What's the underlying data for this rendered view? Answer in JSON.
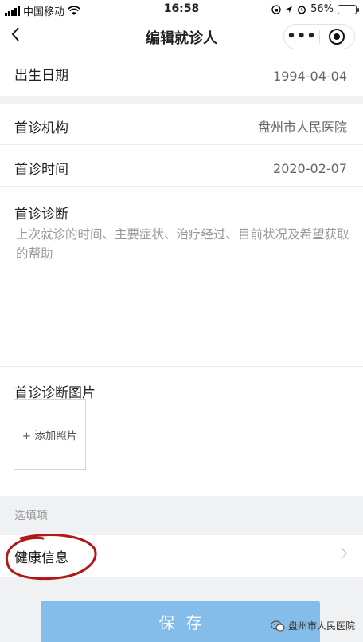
{
  "status_bar": {
    "carrier": "中国移动",
    "time": "16:58",
    "battery": "56%",
    "battery_level": 0.56
  },
  "nav": {
    "title": "编辑就诊人",
    "more_label": "•••"
  },
  "birth": {
    "label": "出生日期",
    "value": "1994-04-04"
  },
  "institution": {
    "label": "首诊机构",
    "value": "盘州市人民医院"
  },
  "visit_time": {
    "label": "首诊时间",
    "value": "2020-02-07"
  },
  "diagnosis": {
    "label": "首诊诊断",
    "placeholder": "上次就诊的时间、主要症状、治疗经过、目前状况及希望获取的帮助"
  },
  "photos": {
    "label": "首诊诊断图片",
    "add_label": "+ 添加照片"
  },
  "optional": {
    "section_title": "选填项",
    "health_label": "健康信息"
  },
  "save_label": "保存",
  "watermark": "盘州市人民医院",
  "colors": {
    "save_button": "#84bde9",
    "annotation_circle": "#b01818",
    "battery": "#f3c13a"
  }
}
